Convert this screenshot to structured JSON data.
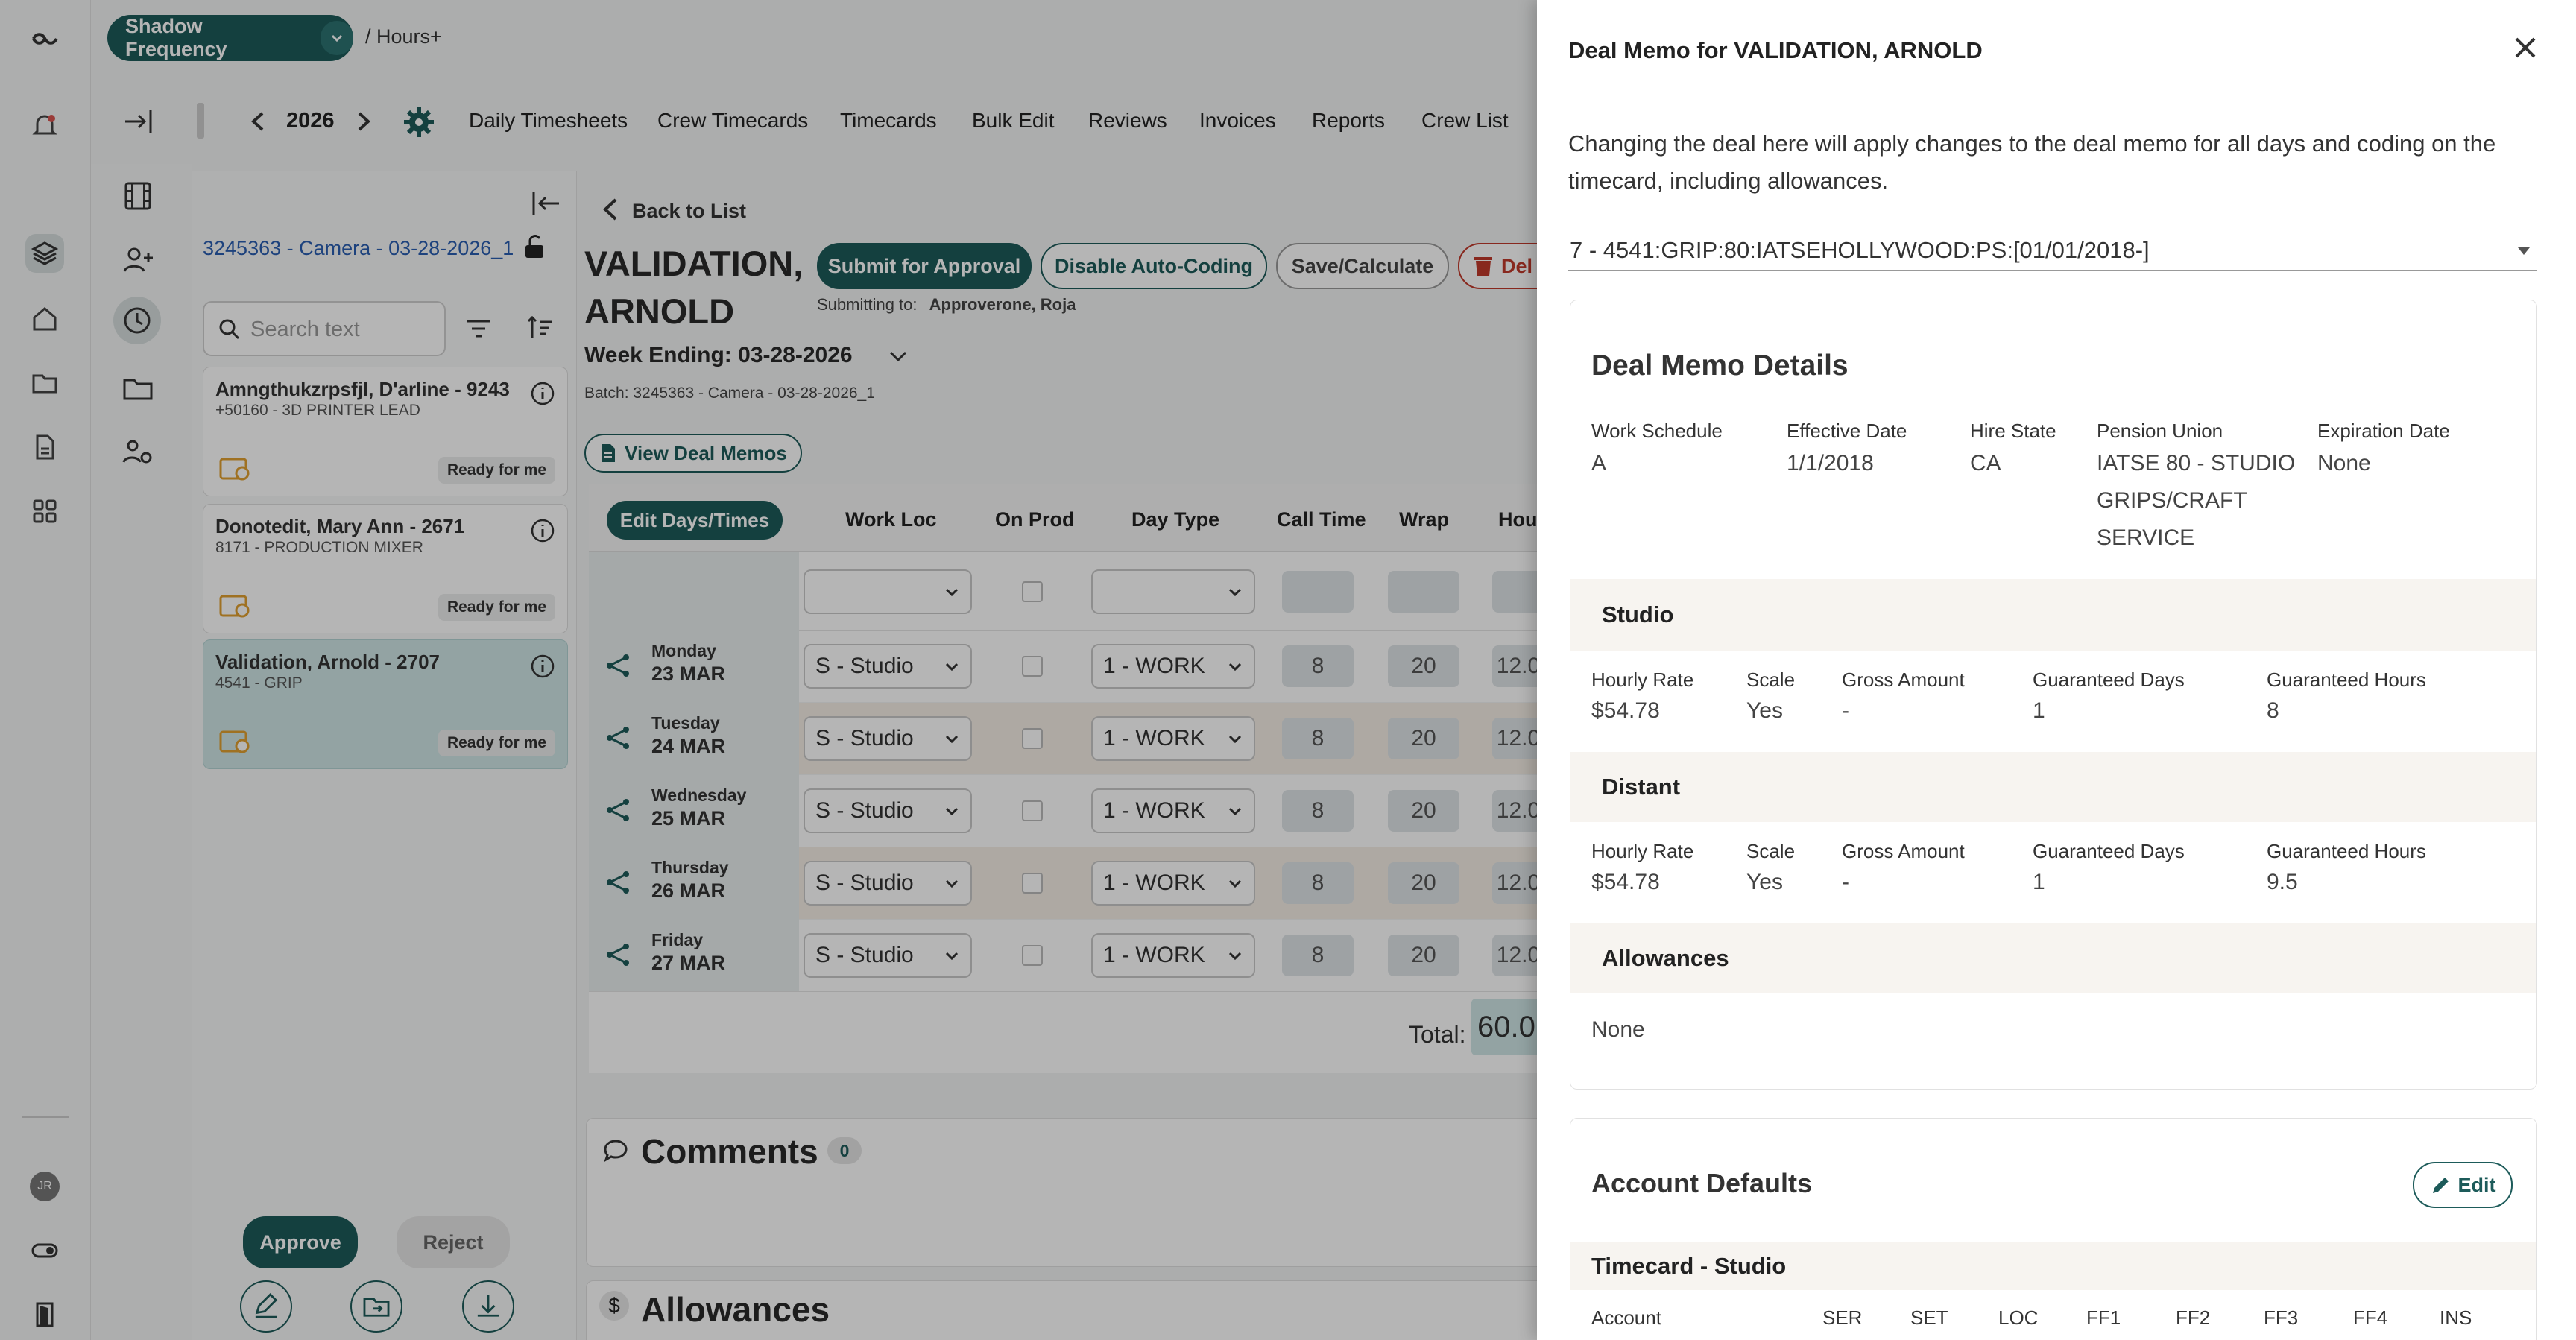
{
  "app": {
    "production": "Shadow Frequency",
    "breadcrumb": "/ Hours+",
    "year": "2026"
  },
  "nav": {
    "links": [
      "Daily Timesheets",
      "Crew Timecards",
      "Timecards",
      "Bulk Edit",
      "Reviews",
      "Invoices",
      "Reports",
      "Crew List"
    ]
  },
  "user": {
    "initials": "JR"
  },
  "list": {
    "batch_link": "3245363 - Camera - 03-28-2026_1",
    "search_placeholder": "Search text",
    "cards": [
      {
        "name": "Amngthukzrpsfjl, D'arline - 9243",
        "role": "+50160 - 3D PRINTER LEAD",
        "status": "Ready for me"
      },
      {
        "name": "Donotedit, Mary Ann - 2671",
        "role": "8171 - PRODUCTION MIXER",
        "status": "Ready for me"
      },
      {
        "name": "Validation, Arnold - 2707",
        "role": "4541 - GRIP",
        "status": "Ready for me"
      }
    ],
    "approve_label": "Approve",
    "reject_label": "Reject"
  },
  "timecard": {
    "back_label": "Back to List",
    "employee_line1": "VALIDATION,",
    "employee_line2": "ARNOLD",
    "submit_label": "Submit for Approval",
    "auto_coding_label": "Disable Auto-Coding",
    "save_label": "Save/Calculate",
    "delete_label": "Del",
    "submitting_to_label": "Submitting to:",
    "submitting_to_value": "Approverone, Roja",
    "week_ending": "Week Ending: 03-28-2026",
    "batch": "Batch: 3245363 - Camera - 03-28-2026_1",
    "view_deal_memos_label": "View Deal Memos",
    "edit_days_label": "Edit Days/Times",
    "columns": [
      "Work Loc",
      "On Prod",
      "Day Type",
      "Call Time",
      "Wrap",
      "Hou"
    ],
    "rows": [
      {
        "day": "Monday",
        "date": "23 MAR",
        "work_loc": "S - Studio",
        "day_type": "1 - WORK",
        "call": "8",
        "wrap": "20",
        "hours": "12.0"
      },
      {
        "day": "Tuesday",
        "date": "24 MAR",
        "work_loc": "S - Studio",
        "day_type": "1 - WORK",
        "call": "8",
        "wrap": "20",
        "hours": "12.0"
      },
      {
        "day": "Wednesday",
        "date": "25 MAR",
        "work_loc": "S - Studio",
        "day_type": "1 - WORK",
        "call": "8",
        "wrap": "20",
        "hours": "12.0"
      },
      {
        "day": "Thursday",
        "date": "26 MAR",
        "work_loc": "S - Studio",
        "day_type": "1 - WORK",
        "call": "8",
        "wrap": "20",
        "hours": "12.0"
      },
      {
        "day": "Friday",
        "date": "27 MAR",
        "work_loc": "S - Studio",
        "day_type": "1 - WORK",
        "call": "8",
        "wrap": "20",
        "hours": "12.0"
      }
    ],
    "total_label": "Total:",
    "total_value": "60.0",
    "comments_label": "Comments",
    "comments_count": "0",
    "allowances_label": "Allowances"
  },
  "drawer": {
    "title": "Deal Memo for VALIDATION, ARNOLD",
    "notice": "Changing the deal here will apply changes to the deal memo for all days and coding on the timecard, including allowances.",
    "deal_select": "7 - 4541:GRIP:80:IATSEHOLLYWOOD:PS:[01/01/2018-]",
    "details_title": "Deal Memo Details",
    "fields": [
      {
        "label": "Work Schedule",
        "value": "A"
      },
      {
        "label": "Effective Date",
        "value": "1/1/2018"
      },
      {
        "label": "Hire State",
        "value": "CA"
      },
      {
        "label": "Pension Union",
        "value": "IATSE 80 - STUDIO GRIPS/CRAFT SERVICE"
      },
      {
        "label": "Expiration Date",
        "value": "None"
      }
    ],
    "rate_labels": [
      "Hourly Rate",
      "Scale",
      "Gross Amount",
      "Guaranteed Days",
      "Guaranteed Hours"
    ],
    "studio": {
      "title": "Studio",
      "values": [
        "$54.78",
        "Yes",
        "-",
        "1",
        "8"
      ]
    },
    "distant": {
      "title": "Distant",
      "values": [
        "$54.78",
        "Yes",
        "-",
        "1",
        "9.5"
      ]
    },
    "allowances": {
      "title": "Allowances",
      "value": "None"
    },
    "account_defaults": {
      "title": "Account Defaults",
      "edit_label": "Edit",
      "section": "Timecard - Studio",
      "columns": [
        "Account",
        "SER",
        "SET",
        "LOC",
        "FF1",
        "FF2",
        "FF3",
        "FF4",
        "INS"
      ]
    }
  },
  "colors": {
    "brand": "#1d5b5a",
    "delete": "#c0392b",
    "active_card": "#cfe6e6",
    "band": "#f7f4f0"
  }
}
